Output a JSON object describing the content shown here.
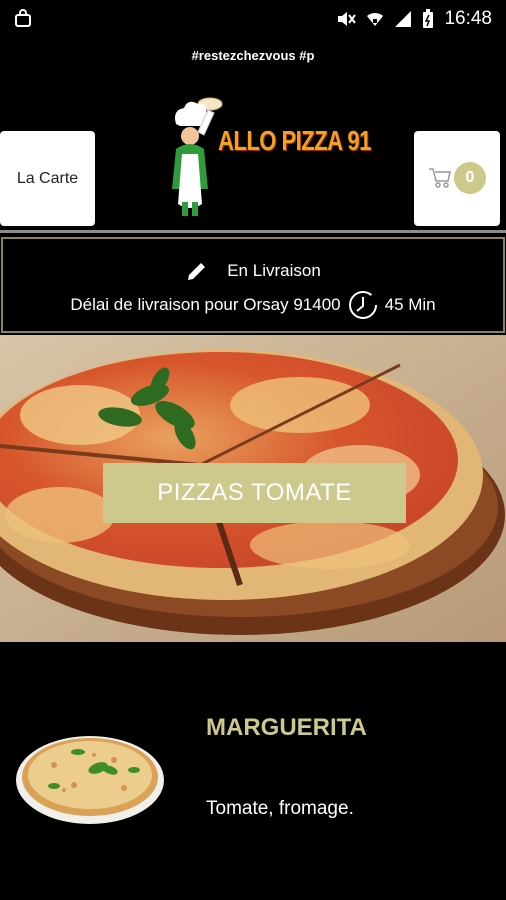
{
  "status_bar": {
    "time": "16:48"
  },
  "marquee": {
    "text": "#restezchezvous #p"
  },
  "header": {
    "menu_label": "La Carte",
    "logo_text": "ALLO PIZZA 91",
    "cart_count": "0"
  },
  "delivery": {
    "mode": "En Livraison",
    "delay_label": "Délai de livraison pour Orsay 91400",
    "delay_value": "45 Min"
  },
  "category": {
    "label": "PIZZAS TOMATE"
  },
  "product": {
    "name": "MARGUERITA",
    "description": "Tomate, fromage."
  },
  "colors": {
    "accent": "#cdc98c",
    "border": "#8a8458",
    "background": "#000000"
  }
}
